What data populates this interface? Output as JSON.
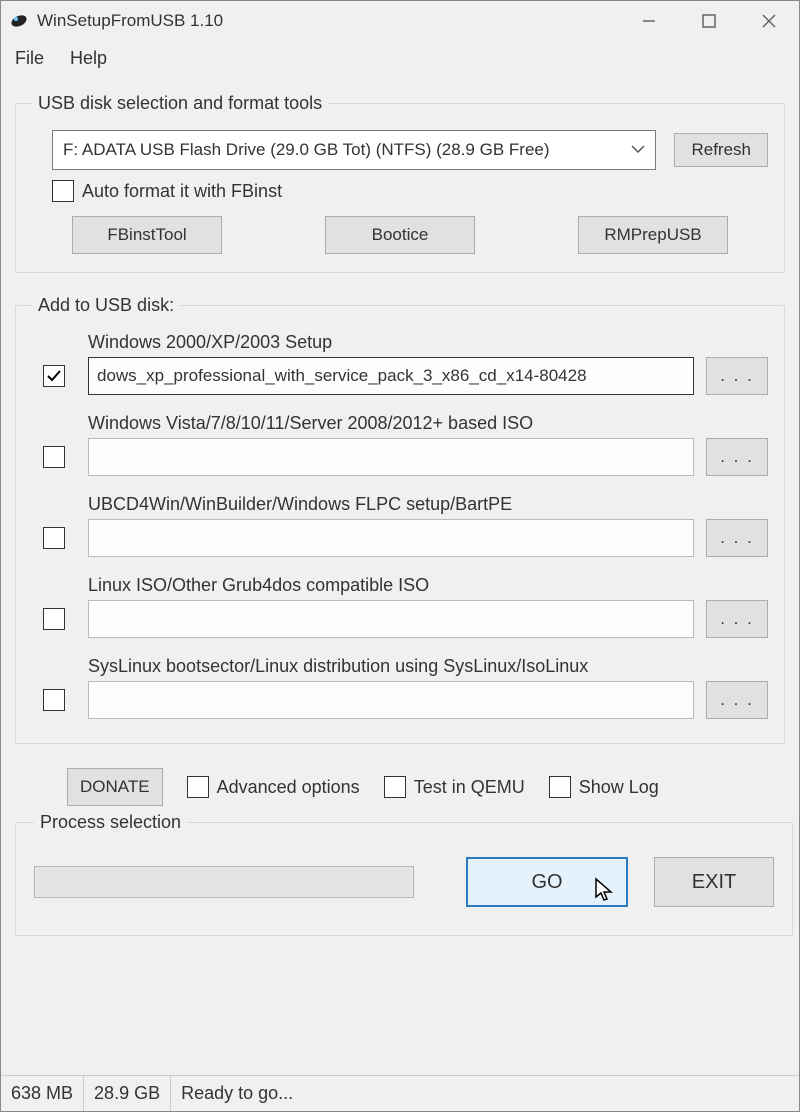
{
  "window": {
    "title": "WinSetupFromUSB 1.10"
  },
  "menu": {
    "file": "File",
    "help": "Help"
  },
  "disk_section": {
    "legend": "USB disk selection and format tools",
    "selected_disk": "F: ADATA USB Flash Drive (29.0 GB Tot) (NTFS) (28.9 GB Free)",
    "refresh_btn": "Refresh",
    "autoformat_label": "Auto format it with FBinst",
    "fbinst_btn": "FBinstTool",
    "bootice_btn": "Bootice",
    "rmprep_btn": "RMPrepUSB"
  },
  "add_section": {
    "legend": "Add to USB disk:",
    "items": [
      {
        "label": "Windows 2000/XP/2003 Setup",
        "checked": true,
        "value": "dows_xp_professional_with_service_pack_3_x86_cd_x14-80428",
        "active": true
      },
      {
        "label": "Windows Vista/7/8/10/11/Server 2008/2012+ based ISO",
        "checked": false,
        "value": "",
        "active": false
      },
      {
        "label": "UBCD4Win/WinBuilder/Windows FLPC setup/BartPE",
        "checked": false,
        "value": "",
        "active": false
      },
      {
        "label": "Linux ISO/Other Grub4dos compatible ISO",
        "checked": false,
        "value": "",
        "active": false
      },
      {
        "label": "SysLinux bootsector/Linux distribution using SysLinux/IsoLinux",
        "checked": false,
        "value": "",
        "active": false
      }
    ],
    "browse_btn": ". . ."
  },
  "options": {
    "donate_btn": "DONATE",
    "advanced_label": "Advanced options",
    "test_label": "Test in QEMU",
    "showlog_label": "Show Log"
  },
  "process": {
    "legend": "Process selection",
    "go_btn": "GO",
    "exit_btn": "EXIT"
  },
  "status": {
    "size": "638 MB",
    "free": "28.9 GB",
    "message": "Ready to go..."
  }
}
